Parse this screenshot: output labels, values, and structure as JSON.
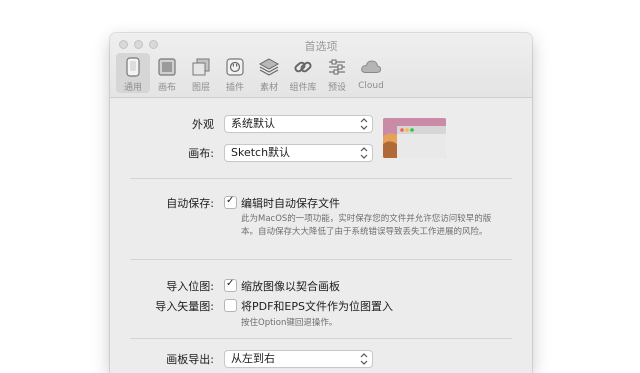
{
  "window": {
    "title": "首选项"
  },
  "toolbar": {
    "items": [
      {
        "label": "通用",
        "icon": "device-phone-icon"
      },
      {
        "label": "画布",
        "icon": "canvas-icon"
      },
      {
        "label": "图层",
        "icon": "layers-icon"
      },
      {
        "label": "插件",
        "icon": "plug-icon"
      },
      {
        "label": "素材",
        "icon": "stack-icon"
      },
      {
        "label": "组件库",
        "icon": "link-icon"
      },
      {
        "label": "预设",
        "icon": "sliders-icon"
      },
      {
        "label": "Cloud",
        "icon": "cloud-icon"
      }
    ]
  },
  "appearance": {
    "label": "外观",
    "value": "系统默认"
  },
  "canvas": {
    "label": "画布:",
    "value": "Sketch默认"
  },
  "autosave": {
    "label": "自动保存:",
    "checkbox_label": "编辑时自动保存文件",
    "checked": true,
    "help_line1": "此为MacOS的一项功能，实时保存您的文件并允许您访问较早的版",
    "help_line2": "本。自动保存大大降低了由于系统错误导致丢失工作进展的风险。"
  },
  "import_bitmap": {
    "label": "导入位图:",
    "checkbox_label": "缩放图像以契合画板",
    "checked": true
  },
  "import_vector": {
    "label": "导入矢量图:",
    "checkbox_label": "将PDF和EPS文件作为位图置入",
    "checked": false,
    "help": "按住Option键回退操作。"
  },
  "artboard_export": {
    "label": "画板导出:",
    "value": "从左到右"
  },
  "colors": {
    "window_bg": "#ececec",
    "active_tab": "#d6d6d6"
  }
}
